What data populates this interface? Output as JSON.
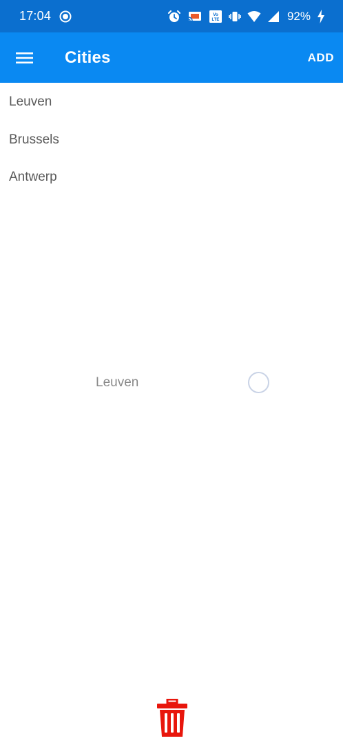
{
  "status_bar": {
    "time": "17:04",
    "battery": "92%",
    "icons": [
      "record-icon",
      "alarm-icon",
      "cast-icon",
      "volte-icon",
      "vibrate-icon",
      "wifi-icon",
      "signal-icon",
      "charging-icon"
    ],
    "volte_label": "VoLTE"
  },
  "app_bar": {
    "title": "Cities",
    "action_label": "ADD",
    "menu_icon": "hamburger-menu-icon",
    "color": "#0a89f2"
  },
  "cities": [
    {
      "label": "Leuven"
    },
    {
      "label": "Brussels"
    },
    {
      "label": "Antwerp"
    }
  ],
  "selection": {
    "label": "Leuven",
    "checked": false
  },
  "footer": {
    "delete_icon": "trash-icon",
    "delete_color": "#e8160c"
  }
}
